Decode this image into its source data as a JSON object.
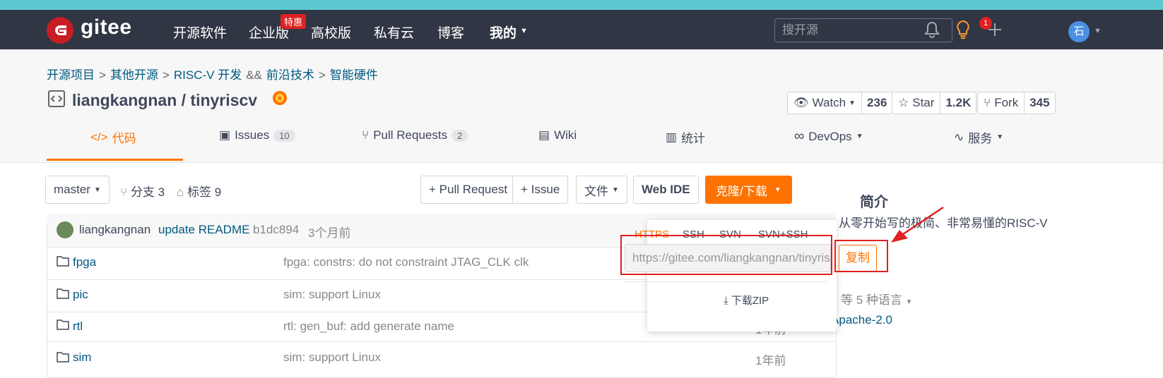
{
  "nav": {
    "logo_text": "gitee",
    "links": [
      "开源软件",
      "企业版",
      "高校版",
      "私有云",
      "博客",
      "我的"
    ],
    "hot_badge": "特惠",
    "search_placeholder": "搜开源",
    "notification_count": "1",
    "avatar_letter": "石"
  },
  "breadcrumb": {
    "items": [
      "开源项目",
      "其他开源",
      "RISC-V 开发",
      "前沿技术",
      "智能硬件"
    ],
    "separator": ">",
    "joiner": "&&"
  },
  "repo": {
    "owner": "liangkangnan",
    "slash": "/",
    "name": "tinyriscv",
    "watch_label": "Watch",
    "watch_count": "236",
    "star_label": "Star",
    "star_count": "1.2K",
    "fork_label": "Fork",
    "fork_count": "345"
  },
  "tabs": [
    {
      "label": "代码",
      "count": ""
    },
    {
      "label": "Issues",
      "count": "10"
    },
    {
      "label": "Pull Requests",
      "count": "2"
    },
    {
      "label": "Wiki",
      "count": ""
    },
    {
      "label": "统计",
      "count": ""
    },
    {
      "label": "DevOps",
      "count": ""
    },
    {
      "label": "服务",
      "count": ""
    }
  ],
  "toolbar": {
    "branch": "master",
    "branches": "分支 3",
    "tags": "标签 9",
    "pull_request": "+ Pull Request",
    "issue": "+ Issue",
    "file": "文件",
    "web_ide": "Web IDE",
    "clone": "克隆/下载"
  },
  "commit": {
    "author": "liangkangnan",
    "message": "update README",
    "hash": "b1dc894",
    "time": "3个月前"
  },
  "files": [
    {
      "name": "fpga",
      "message": "fpga: constrs: do not constraint JTAG_CLK clk",
      "time": ""
    },
    {
      "name": "pic",
      "message": "sim: support Linux",
      "time": ""
    },
    {
      "name": "rtl",
      "message": "rtl: gen_buf: add generate name",
      "time": "1年前"
    },
    {
      "name": "sim",
      "message": "sim: support Linux",
      "time": "1年前"
    }
  ],
  "clone_panel": {
    "tabs": [
      "HTTPS",
      "SSH",
      "SVN",
      "SVN+SSH"
    ],
    "url": "https://gitee.com/liangkangnan/tinyriscv.git",
    "copy": "复制",
    "download_zip": "下载ZIP"
  },
  "sidebar": {
    "title": "简介",
    "desc": "从零开始写的极简、非常易懂的RISC-V",
    "languages": "等 5 种语言",
    "license": "Apache-2.0"
  },
  "colors": {
    "accent": "#fe7300",
    "nav_bg": "#303643",
    "link": "#005980",
    "annotation": "#e02020"
  }
}
